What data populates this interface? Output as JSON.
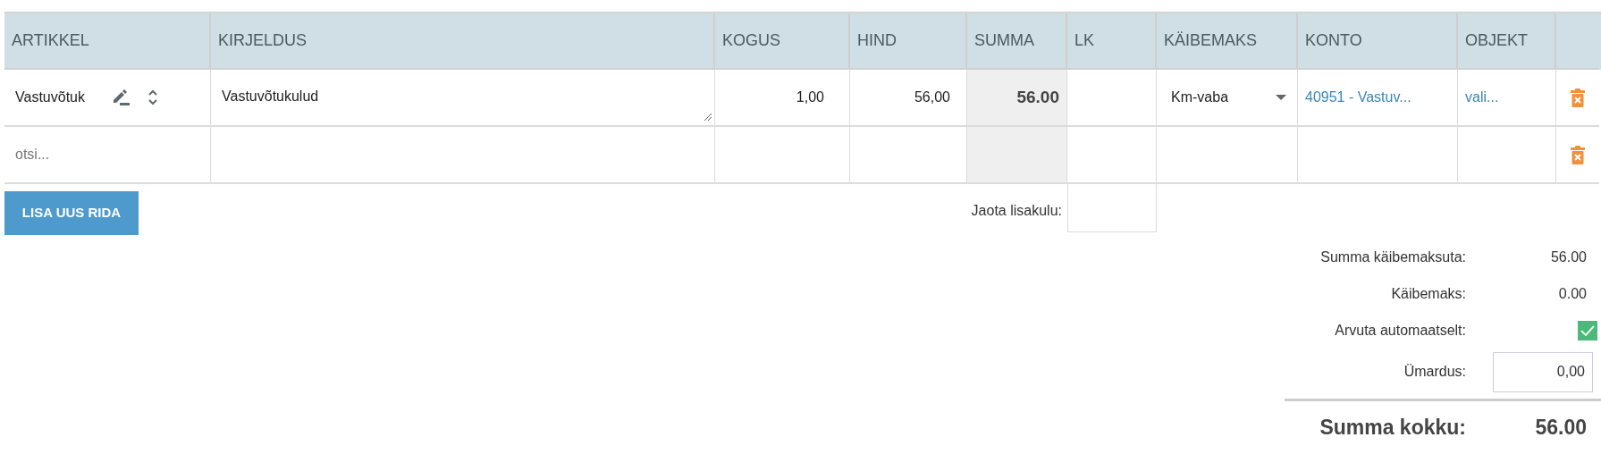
{
  "table": {
    "columns": [
      "ARTIKKEL",
      "KIRJELDUS",
      "KOGUS",
      "HIND",
      "SUMMA",
      "LK",
      "KÄIBEMAKS",
      "KONTO",
      "OBJEKT"
    ],
    "rows": [
      {
        "article": {
          "value": "Vastuvõtuk"
        },
        "description": "Vastuvõtukulud",
        "quantity": "1,00",
        "price": "56,00",
        "sum": "56.00",
        "vat": "Km-vaba",
        "account": "40951 - Vastuv...",
        "object": "vali..."
      },
      {
        "article": {
          "placeholder": "otsi..."
        }
      }
    ]
  },
  "add_row_button": "LISA UUS RIDA",
  "allocate": {
    "label": "Jaota lisakulu:"
  },
  "totals": [
    {
      "kind": "value",
      "label": "Summa käibemaksuta:",
      "value": "56.00"
    },
    {
      "kind": "value",
      "label": "Käibemaks:",
      "value": "0.00"
    },
    {
      "kind": "checkbox",
      "label": "Arvuta automaatselt:",
      "checked": true
    },
    {
      "kind": "input",
      "label": "Ümardus:",
      "value": "0,00"
    }
  ],
  "grand_total": {
    "label": "Summa kokku:",
    "value": "56.00"
  }
}
